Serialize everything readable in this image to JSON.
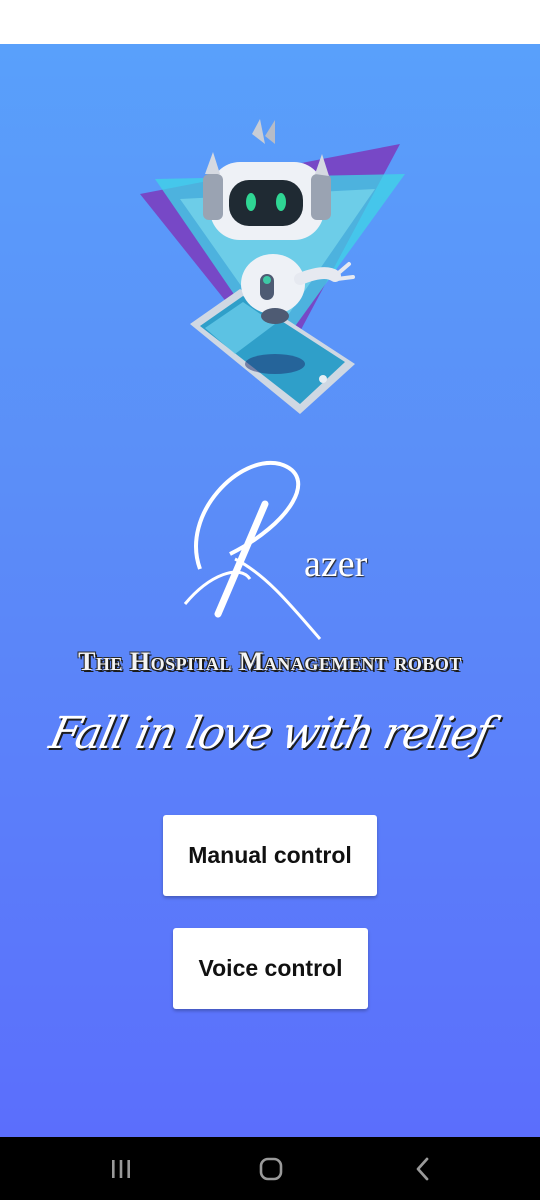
{
  "app": {
    "brand_name": "Razer",
    "brand_initial": "R",
    "brand_rest": "azer",
    "subtitle": "The Hospital Management robot",
    "tagline": "Fall in love with relief"
  },
  "buttons": {
    "manual_label": "Manual control",
    "voice_label": "Voice control"
  },
  "icons": {
    "robot": "robot-on-phone-illustration",
    "recents": "recents-icon",
    "home": "home-icon",
    "back": "back-icon"
  },
  "colors": {
    "background_top": "#59a0fb",
    "background_bottom": "#5b6efc",
    "button_bg": "#ffffff",
    "nav_bar": "#000000"
  }
}
